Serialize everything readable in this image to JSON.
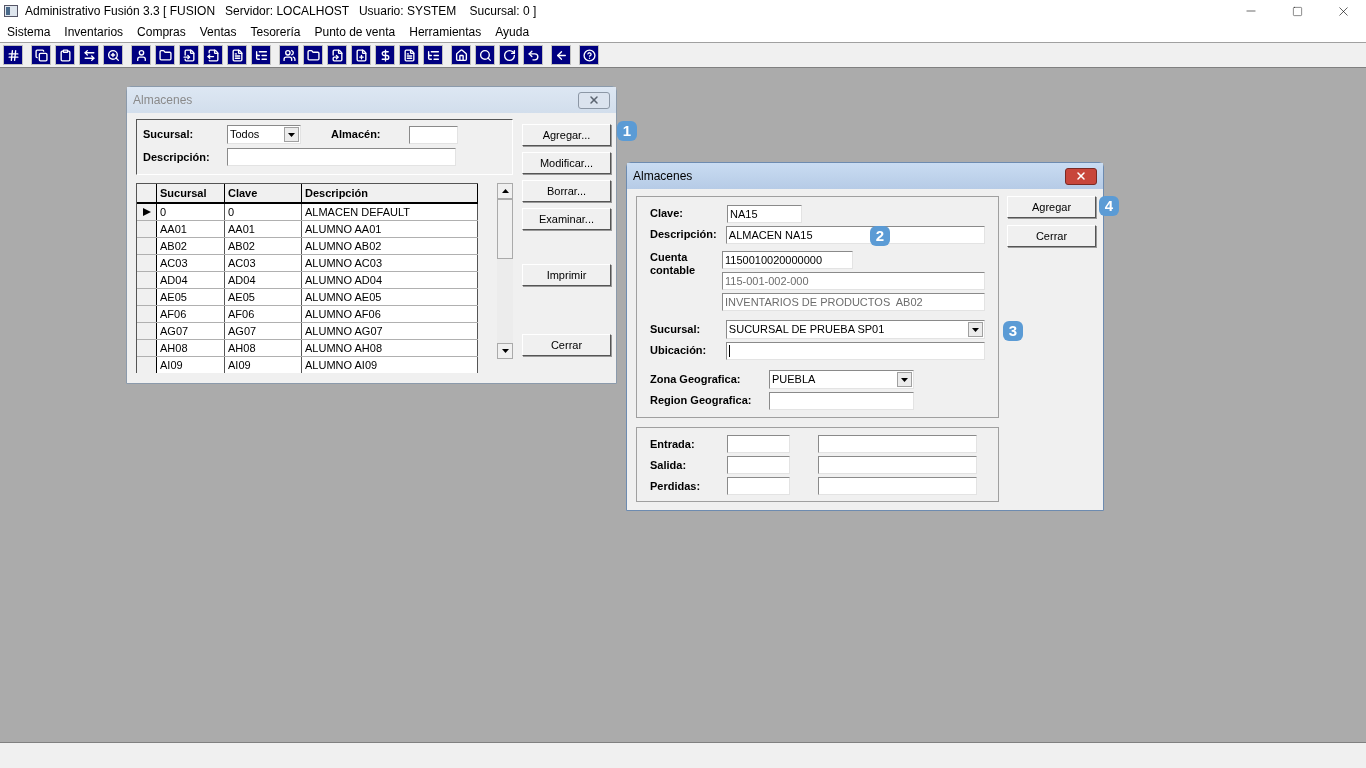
{
  "window": {
    "title": "Administrativo Fusión 3.3 [ FUSION   Servidor: LOCALHOST   Usuario: SYSTEM    Sucursal: 0 ]"
  },
  "menu": [
    "Sistema",
    "Inventarios",
    "Compras",
    "Ventas",
    "Tesorería",
    "Punto de venta",
    "Herramientas",
    "Ayuda"
  ],
  "list_window": {
    "title": "Almacenes",
    "active": false,
    "filters": {
      "sucursal_label": "Sucursal:",
      "sucursal_value": "Todos",
      "almacen_label": "Almacén:",
      "descripcion_label": "Descripción:"
    },
    "table": {
      "columns": [
        "Sucursal",
        "Clave",
        "Descripción"
      ],
      "rows": [
        {
          "cells": [
            "0",
            "0",
            "ALMACEN DEFAULT"
          ],
          "selected": true
        },
        {
          "cells": [
            "AA01",
            "AA01",
            "ALUMNO AA01"
          ],
          "selected": false
        },
        {
          "cells": [
            "AB02",
            "AB02",
            "ALUMNO AB02"
          ],
          "selected": false
        },
        {
          "cells": [
            "AC03",
            "AC03",
            "ALUMNO AC03"
          ],
          "selected": false
        },
        {
          "cells": [
            "AD04",
            "AD04",
            "ALUMNO AD04"
          ],
          "selected": false
        },
        {
          "cells": [
            "AE05",
            "AE05",
            "ALUMNO AE05"
          ],
          "selected": false
        },
        {
          "cells": [
            "AF06",
            "AF06",
            "ALUMNO AF06"
          ],
          "selected": false
        },
        {
          "cells": [
            "AG07",
            "AG07",
            "ALUMNO AG07"
          ],
          "selected": false
        },
        {
          "cells": [
            "AH08",
            "AH08",
            "ALUMNO AH08"
          ],
          "selected": false
        },
        {
          "cells": [
            "AI09",
            "AI09",
            "ALUMNO AI09"
          ],
          "selected": false
        }
      ]
    },
    "buttons": [
      "Agregar...",
      "Modificar...",
      "Borrar...",
      "Examinar...",
      "Imprimir",
      "Cerrar"
    ],
    "callout": "1"
  },
  "edit_window": {
    "title": "Almacenes",
    "active": true,
    "clave": {
      "label": "Clave:",
      "value": "NA15"
    },
    "descripcion": {
      "label": "Descripción:",
      "value": "ALMACEN NA15",
      "callout": "2"
    },
    "cuenta": {
      "label": "Cuenta contable",
      "value": "1150010020000000",
      "code": "115-001-002-000",
      "name": "INVENTARIOS DE PRODUCTOS  AB02"
    },
    "sucursal": {
      "label": "Sucursal:",
      "value": "SUCURSAL DE PRUEBA SP01",
      "callout": "3"
    },
    "ubicacion": {
      "label": "Ubicación:",
      "focused": true
    },
    "zona": {
      "label": "Zona Geografica:",
      "value": "PUEBLA"
    },
    "region": {
      "label": "Region Geografica:"
    },
    "movimientos": [
      {
        "label": "Entrada:"
      },
      {
        "label": "Salida:"
      },
      {
        "label": "Perdidas:"
      }
    ],
    "buttons": [
      "Agregar",
      "Cerrar"
    ],
    "callout": "4"
  }
}
